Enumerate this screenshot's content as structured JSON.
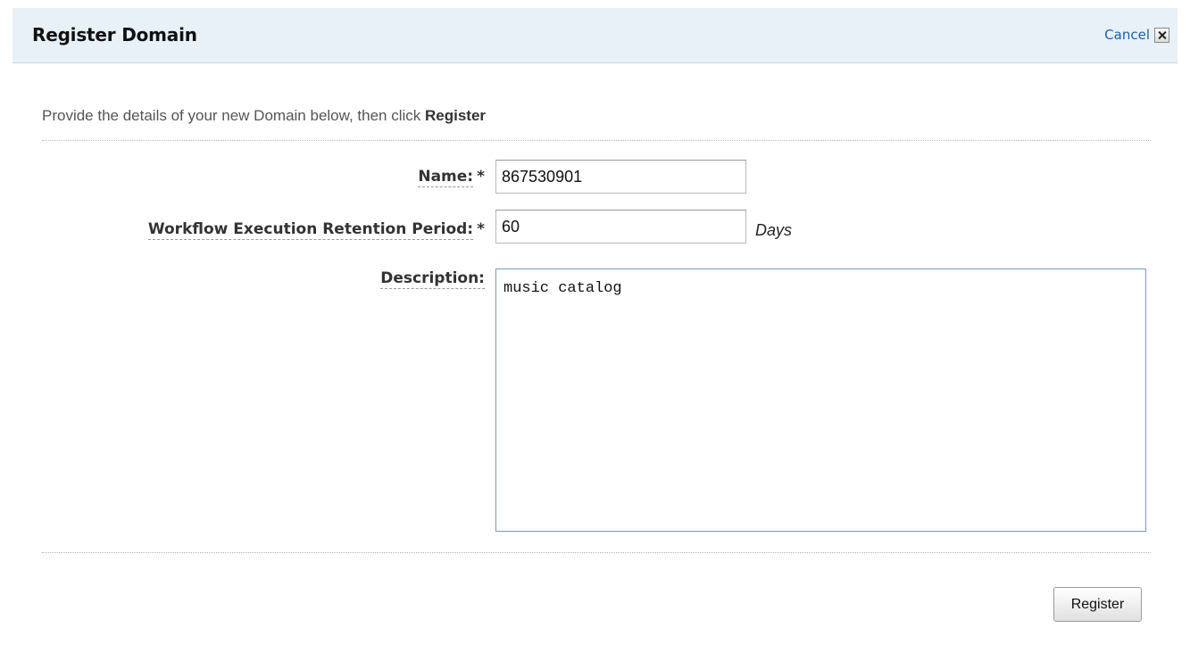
{
  "header": {
    "title": "Register Domain",
    "cancel_label": "Cancel",
    "close_icon": "close-icon"
  },
  "instructions": {
    "prefix": "Provide the details of your new Domain below, then click ",
    "action": "Register"
  },
  "form": {
    "name": {
      "label": "Name:",
      "required_mark": "*",
      "value": "867530901"
    },
    "retention": {
      "label": "Workflow Execution Retention Period:",
      "required_mark": "*",
      "value": "60",
      "unit": "Days"
    },
    "description": {
      "label": "Description:",
      "value": "music catalog"
    }
  },
  "footer": {
    "register_label": "Register"
  },
  "colors": {
    "header_bg": "#e8f0f8",
    "link": "#1f5fa8"
  }
}
